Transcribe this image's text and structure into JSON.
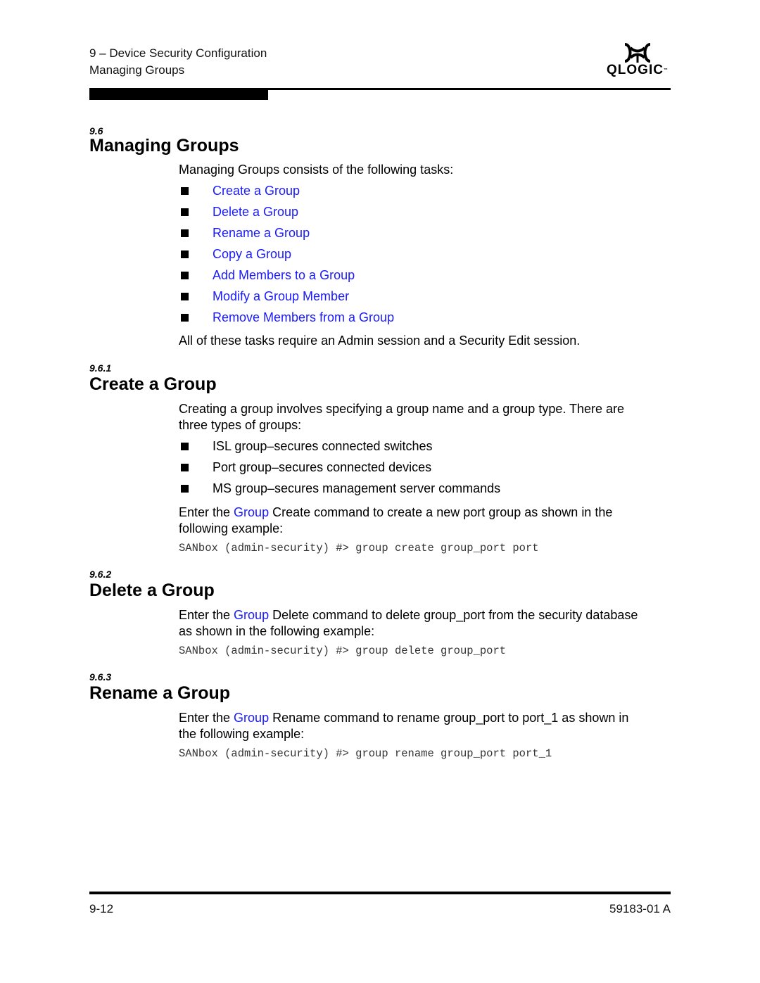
{
  "header": {
    "chapter": "9 – Device Security Configuration",
    "section": "Managing Groups",
    "logo_text": "QLOGIC",
    "logo_tm": "™",
    "logo_icon": "qlogic-logo-icon"
  },
  "sections": {
    "managing": {
      "number": "9.6",
      "title": "Managing Groups",
      "intro": "Managing Groups consists of the following tasks:",
      "tasks": [
        "Create a Group",
        "Delete a Group",
        "Rename a Group",
        "Copy a Group",
        "Add Members to a Group",
        "Modify a Group Member",
        "Remove Members from a Group"
      ],
      "note": "All of these tasks require an Admin session and a Security Edit session."
    },
    "create": {
      "number": "9.6.1",
      "title": "Create a Group",
      "intro_line1": "Creating a group involves specifying a group name and a group type. There are",
      "intro_line2": "three types of groups:",
      "types": [
        "ISL group–secures connected switches",
        "Port group–secures connected devices",
        "MS group–secures management server commands"
      ],
      "enter_the": "Enter the ",
      "link": "Group",
      "desc_rest": " Create command to create a new port group as shown in the",
      "desc_line2": "following example:",
      "command": "SANbox (admin-security) #> group create group_port port"
    },
    "delete": {
      "number": "9.6.2",
      "title": "Delete a Group",
      "enter_the": "Enter the ",
      "link": "Group",
      "desc_rest": " Delete command to delete group_port from the security database",
      "desc_line2": "as shown in the following example:",
      "command": "SANbox (admin-security) #> group delete group_port"
    },
    "rename": {
      "number": "9.6.3",
      "title": "Rename a Group",
      "enter_the": "Enter the ",
      "link": "Group",
      "desc_rest": " Rename command to rename group_port to port_1 as shown in",
      "desc_line2": "the following example:",
      "command": "SANbox (admin-security) #> group rename group_port port_1"
    }
  },
  "footer": {
    "page_number": "9-12",
    "doc_number": "59183-01 A"
  },
  "colors": {
    "link": "#1a1aff",
    "text": "#000000",
    "code": "#333333"
  }
}
